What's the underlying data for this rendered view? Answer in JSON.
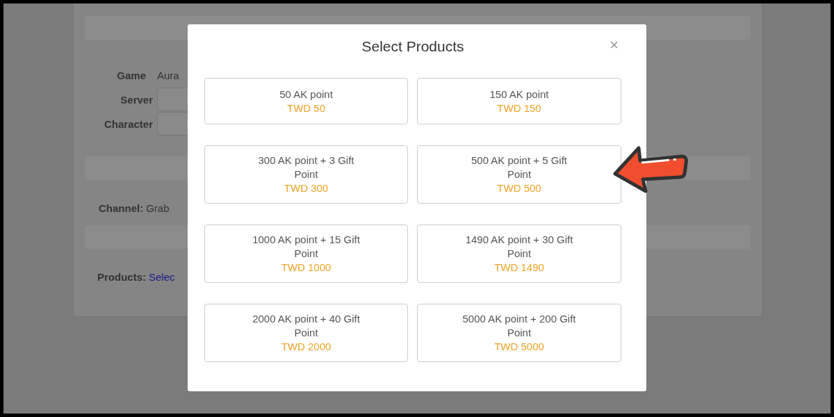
{
  "background_form": {
    "fields": [
      {
        "label": "Game",
        "value": "Aura",
        "kind": "text"
      },
      {
        "label": "Server",
        "kind": "input"
      },
      {
        "label": "Character",
        "kind": "input"
      }
    ],
    "channel": {
      "label": "Channel:",
      "value": "Grab"
    },
    "products": {
      "label": "Products:",
      "link": "Selec"
    }
  },
  "modal": {
    "title": "Select Products",
    "close": "×",
    "products": [
      {
        "name": "50 AK point",
        "price": "TWD 50"
      },
      {
        "name": "150 AK point",
        "price": "TWD 150"
      },
      {
        "name": "300 AK point + 3 Gift Point",
        "price": "TWD 300"
      },
      {
        "name": "500 AK point + 5 Gift Point",
        "price": "TWD 500"
      },
      {
        "name": "1000 AK point + 15 Gift Point",
        "price": "TWD 1000"
      },
      {
        "name": "1490 AK point + 30 Gift Point",
        "price": "TWD 1490"
      },
      {
        "name": "2000 AK point + 40 Gift Point",
        "price": "TWD 2000"
      },
      {
        "name": "5000 AK point + 200 Gift Point",
        "price": "TWD 5000"
      }
    ]
  }
}
